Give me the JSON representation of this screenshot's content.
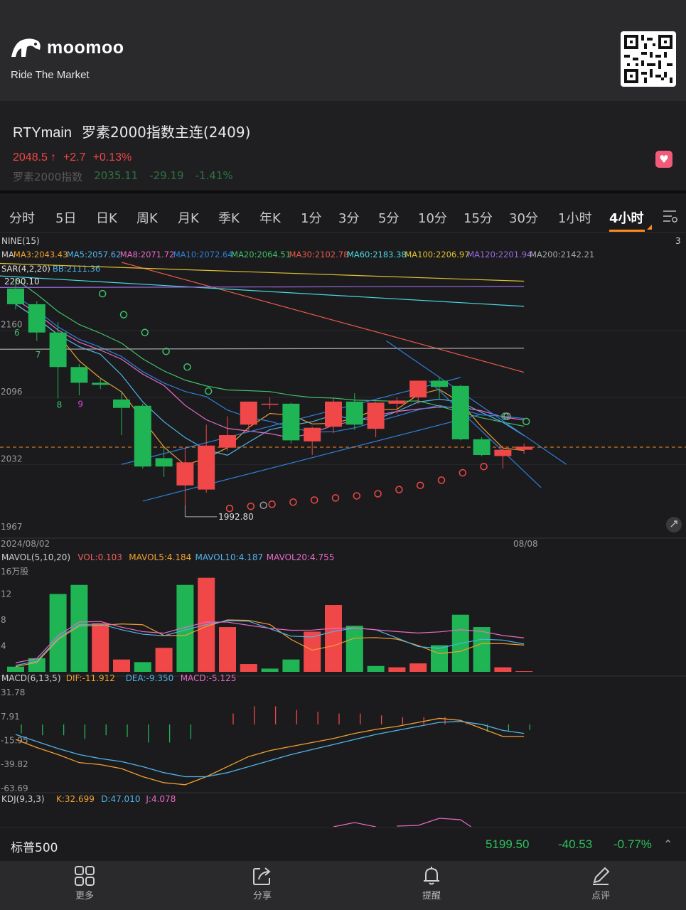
{
  "header": {
    "brand": "moomoo",
    "slogan": "Ride The Market"
  },
  "quote": {
    "code": "RTYmain",
    "name": "罗素2000指数主连(2409)",
    "price": "2048.5",
    "price_arrow": "↑",
    "change": "+2.7",
    "change_pct": "+0.13%",
    "index_name": "罗素2000指数",
    "index_price": "2035.11",
    "index_change": "-29.19",
    "index_change_pct": "-1.41%"
  },
  "tabs": [
    "分时",
    "5日",
    "日K",
    "周K",
    "月K",
    "季K",
    "年K",
    "1分",
    "3分",
    "5分",
    "10分",
    "15分",
    "30分",
    "1小时",
    "4小时"
  ],
  "active_tab": "4小时",
  "chart_data": [
    {
      "type": "candlestick",
      "title": "NINE(15)",
      "x_start_label": "2024/08/02",
      "x_end_label": "08/08",
      "y_ticks": [
        "2160",
        "2096",
        "2032",
        "1967"
      ],
      "ylim": [
        1967,
        2225
      ],
      "low_annotation": "1992.80",
      "high_annotation": "2200.10",
      "last_price_line": 2048.5,
      "candles": [
        {
          "o": 2200,
          "h": 2210,
          "l": 2180,
          "c": 2185
        },
        {
          "o": 2185,
          "h": 2188,
          "l": 2150,
          "c": 2158
        },
        {
          "o": 2158,
          "h": 2168,
          "l": 2095,
          "c": 2125
        },
        {
          "o": 2125,
          "h": 2128,
          "l": 2098,
          "c": 2110
        },
        {
          "o": 2110,
          "h": 2115,
          "l": 2104,
          "c": 2108
        },
        {
          "o": 2094,
          "h": 2102,
          "l": 2060,
          "c": 2086
        },
        {
          "o": 2088,
          "h": 2090,
          "l": 2028,
          "c": 2030
        },
        {
          "o": 2038,
          "h": 2050,
          "l": 2020,
          "c": 2030
        },
        {
          "o": 2012,
          "h": 2048,
          "l": 1993,
          "c": 2034
        },
        {
          "o": 2008,
          "h": 2070,
          "l": 2005,
          "c": 2050
        },
        {
          "o": 2048,
          "h": 2078,
          "l": 2045,
          "c": 2060
        },
        {
          "o": 2070,
          "h": 2092,
          "l": 2065,
          "c": 2092
        },
        {
          "o": 2089,
          "h": 2096,
          "l": 2085,
          "c": 2090
        },
        {
          "o": 2090,
          "h": 2091,
          "l": 2052,
          "c": 2055
        },
        {
          "o": 2054,
          "h": 2068,
          "l": 2041,
          "c": 2067
        },
        {
          "o": 2068,
          "h": 2095,
          "l": 2062,
          "c": 2092
        },
        {
          "o": 2092,
          "h": 2100,
          "l": 2065,
          "c": 2070
        },
        {
          "o": 2066,
          "h": 2092,
          "l": 2058,
          "c": 2091
        },
        {
          "o": 2090,
          "h": 2096,
          "l": 2080,
          "c": 2093
        },
        {
          "o": 2096,
          "h": 2112,
          "l": 2090,
          "c": 2112
        },
        {
          "o": 2112,
          "h": 2115,
          "l": 2095,
          "c": 2106
        },
        {
          "o": 2107,
          "h": 2108,
          "l": 2055,
          "c": 2056
        },
        {
          "o": 2056,
          "h": 2058,
          "l": 2040,
          "c": 2041
        },
        {
          "o": 2040,
          "h": 2050,
          "l": 2028,
          "c": 2046
        },
        {
          "o": 2046,
          "h": 2052,
          "l": 2042,
          "c": 2049
        }
      ],
      "ma": [
        {
          "name": "MA",
          "label": "MA",
          "color": "#d0d0d0"
        },
        {
          "name": "MA3",
          "label": "MA3:2043.43",
          "color": "#f0a030"
        },
        {
          "name": "MA5",
          "label": "MA5:2057.62",
          "color": "#4fb3e8"
        },
        {
          "name": "MA8",
          "label": "MA8:2071.72",
          "color": "#e86ac8"
        },
        {
          "name": "MA10",
          "label": "MA10:2072.64",
          "color": "#2e7fd8"
        },
        {
          "name": "MA20",
          "label": "MA20:2064.51",
          "color": "#3ec06a"
        },
        {
          "name": "MA30",
          "label": "MA30:2102.78",
          "color": "#e8584a"
        },
        {
          "name": "MA60",
          "label": "MA60:2183.38",
          "color": "#48d8e0"
        },
        {
          "name": "MA100",
          "label": "MA100:2206.97",
          "color": "#e0c030"
        },
        {
          "name": "MA120",
          "label": "MA120:2201.94",
          "color": "#9a6ae0"
        },
        {
          "name": "MA200",
          "label": "MA200:2142.21",
          "color": "#a8a8a8"
        }
      ],
      "sar_label": "SAR(4,2,20)",
      "bb_label": "BB:2111.36",
      "nine_counts": [
        "6",
        "7",
        "8",
        "9"
      ],
      "sar_points": [
        2195,
        2175,
        2158,
        2140,
        2125,
        2102,
        1990,
        1992,
        1994,
        1996,
        1998,
        2000,
        2002,
        2004,
        2008,
        2012,
        2017,
        2024,
        2030,
        2078,
        2073
      ]
    },
    {
      "type": "bar",
      "title": "MAVOL(5,10,20)",
      "unit": "16万股",
      "y_ticks": [
        "12",
        "8",
        "4"
      ],
      "ylim": [
        0,
        16
      ],
      "labels": [
        {
          "text": "MAVOL(5,10,20)",
          "color": "#cfcfcf"
        },
        {
          "text": "VOL:0.103",
          "color": "#f06060"
        },
        {
          "text": "MAVOL5:4.184",
          "color": "#f0a030"
        },
        {
          "text": "MAVOL10:4.187",
          "color": "#4fb3e8"
        },
        {
          "text": "MAVOL20:4.755",
          "color": "#e86ac8"
        }
      ],
      "values": [
        0.8,
        2.1,
        12.0,
        13.4,
        7.5,
        1.9,
        1.5,
        3.7,
        13.4,
        14.5,
        6.9,
        1.2,
        0.5,
        1.9,
        6.2,
        10.3,
        7.1,
        0.9,
        0.7,
        1.3,
        4.1,
        8.8,
        6.9,
        0.7,
        0.1
      ],
      "up": [
        false,
        false,
        false,
        false,
        true,
        true,
        false,
        true,
        false,
        true,
        true,
        true,
        false,
        false,
        true,
        true,
        false,
        false,
        true,
        true,
        false,
        false,
        false,
        true,
        true
      ]
    },
    {
      "type": "macd",
      "title": "MACD(6,13,5)",
      "labels": [
        {
          "text": "MACD(6,13,5)",
          "color": "#cfcfcf"
        },
        {
          "text": "DIF:-11.912",
          "color": "#f0a030"
        },
        {
          "text": "DEA:-9.350",
          "color": "#4fb3e8"
        },
        {
          "text": "MACD:-5.125",
          "color": "#e86ac8"
        }
      ],
      "y_ticks": [
        "31.78",
        "7.91",
        "-15.95",
        "-39.82",
        "-63.69"
      ],
      "ylim": [
        -63.69,
        31.78
      ],
      "dif": [
        -15,
        -23,
        -30,
        -38,
        -40,
        -44,
        -52,
        -58,
        -60,
        -52,
        -42,
        -32,
        -26,
        -22,
        -18,
        -14,
        -9,
        -5,
        -2,
        2,
        6,
        4,
        -4,
        -12,
        -12
      ],
      "dea": [
        -10,
        -17,
        -24,
        -30,
        -34,
        -37,
        -42,
        -48,
        -52,
        -52,
        -48,
        -42,
        -36,
        -30,
        -25,
        -20,
        -15,
        -10,
        -6,
        -2,
        2,
        3,
        0,
        -6,
        -9
      ],
      "hist": [
        -10,
        -12,
        -12,
        -16,
        -12,
        -14,
        -20,
        -20,
        -16,
        0,
        12,
        20,
        20,
        16,
        14,
        12,
        12,
        10,
        8,
        8,
        8,
        2,
        -8,
        -8,
        -6
      ]
    },
    {
      "type": "line",
      "title": "KDJ(9,3,3)",
      "labels": [
        {
          "text": "KDJ(9,3,3)",
          "color": "#cfcfcf"
        },
        {
          "text": "K:32.699",
          "color": "#f0a030"
        },
        {
          "text": "D:47.010",
          "color": "#4fb3e8"
        },
        {
          "text": "J:4.078",
          "color": "#e86ac8"
        }
      ]
    }
  ],
  "bottom_quote": {
    "name": "标普500",
    "price": "5199.50",
    "change": "-40.53",
    "change_pct": "-0.77%"
  },
  "nav": [
    {
      "label": "更多",
      "icon": "grid-icon"
    },
    {
      "label": "分享",
      "icon": "share-icon"
    },
    {
      "label": "提醒",
      "icon": "bell-icon"
    },
    {
      "label": "点评",
      "icon": "pen-icon"
    }
  ]
}
